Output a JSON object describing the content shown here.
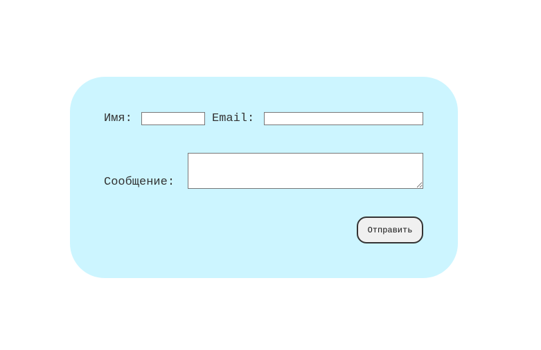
{
  "form": {
    "name_label": "Имя:",
    "name_value": "",
    "email_label": "Email:",
    "email_value": "",
    "message_label": "Сообщение:",
    "message_value": "",
    "submit_label": "Отправить"
  },
  "colors": {
    "card_background": "#ccf5ff",
    "page_background": "#ffffff",
    "button_background": "#f0f0f0",
    "button_border": "#333333"
  }
}
